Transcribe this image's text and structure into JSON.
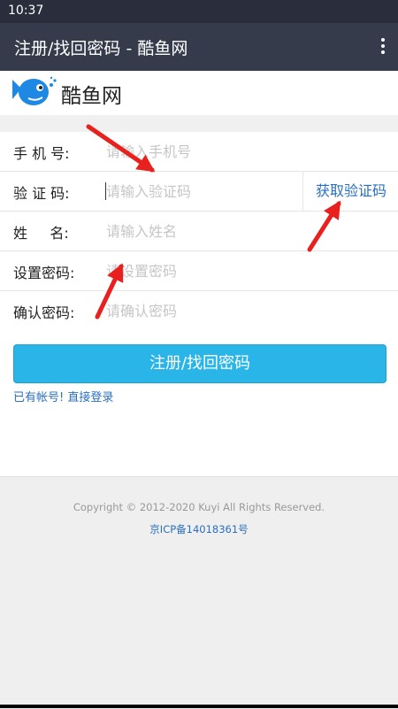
{
  "status": {
    "time": "10:37"
  },
  "appbar": {
    "title": "注册/找回密码 - 酷鱼网",
    "menu_icon": "more-vert-icon"
  },
  "brand": {
    "name": "酷鱼网",
    "logo_icon": "fish-logo-icon"
  },
  "form": {
    "phone": {
      "label": "手 机 号:",
      "placeholder": "请输入手机号"
    },
    "code": {
      "label": "验 证 码:",
      "placeholder": "请输入验证码",
      "get_code_label": "获取验证码"
    },
    "name": {
      "label": "姓     名:",
      "placeholder": "请输入姓名"
    },
    "password": {
      "label": "设置密码:",
      "placeholder": "请设置密码"
    },
    "confirm": {
      "label": "确认密码:",
      "placeholder": "请确认密码"
    }
  },
  "submit_label": "注册/找回密码",
  "login": {
    "prefix": "已有帐号!",
    "link": "直接登录"
  },
  "footer": {
    "copyright": "Copyright © 2012-2020 Kuyi All Rights Reserved.",
    "icp": "京ICP备14018361号"
  },
  "colors": {
    "appbar": "#363b4b",
    "accent": "#2ab5e8",
    "link": "#2a6fc0",
    "arrow": "#e8201e"
  }
}
